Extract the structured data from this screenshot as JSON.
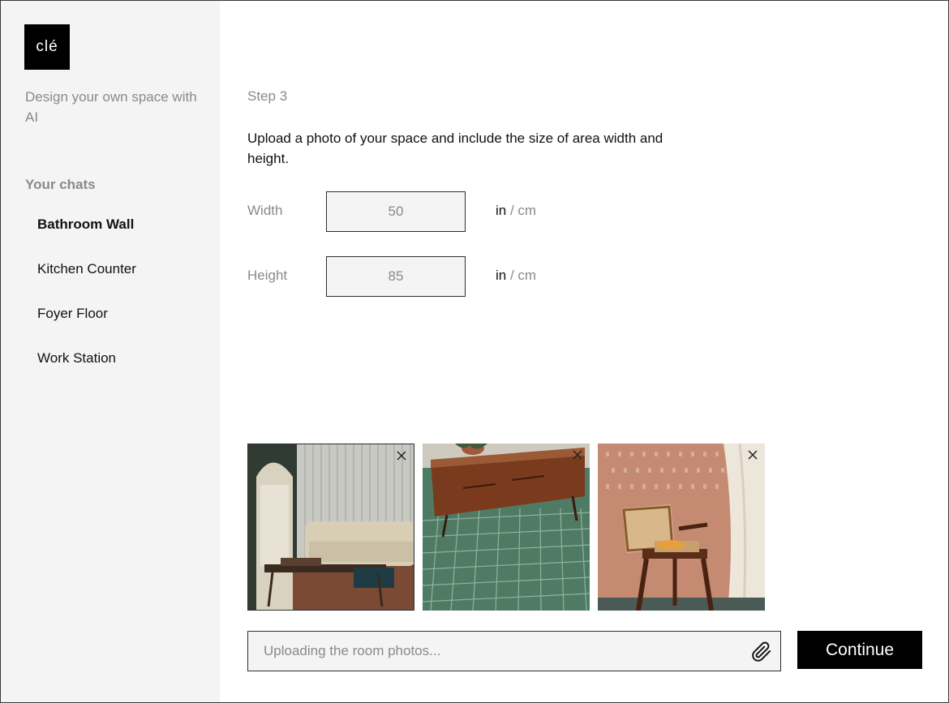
{
  "brand": {
    "logo_text": "clé",
    "tagline": "Design your own space with AI"
  },
  "sidebar": {
    "heading": "Your chats",
    "items": [
      {
        "label": "Bathroom Wall",
        "active": true
      },
      {
        "label": "Kitchen Counter",
        "active": false
      },
      {
        "label": "Foyer Floor",
        "active": false
      },
      {
        "label": "Work Station",
        "active": false
      }
    ]
  },
  "main": {
    "step_label": "Step 3",
    "instructions": "Upload a photo of your space and include the size of area width and height.",
    "width": {
      "label": "Width",
      "value": "50",
      "unit_in": "in",
      "unit_sep": " / ",
      "unit_cm": "cm"
    },
    "height": {
      "label": "Height",
      "value": "85",
      "unit_in": "in",
      "unit_sep": " / ",
      "unit_cm": "cm"
    },
    "photos": [
      {
        "icon": "photo-living-room"
      },
      {
        "icon": "photo-green-tile-floor"
      },
      {
        "icon": "photo-cane-chair"
      }
    ],
    "upload": {
      "placeholder": "Uploading the room photos..."
    },
    "continue_label": "Continue"
  },
  "colors": {
    "accent": "#000000",
    "sidebar_bg": "#f4f4f4",
    "muted_text": "#8a8a8a",
    "input_bg": "#f4f4f4"
  }
}
